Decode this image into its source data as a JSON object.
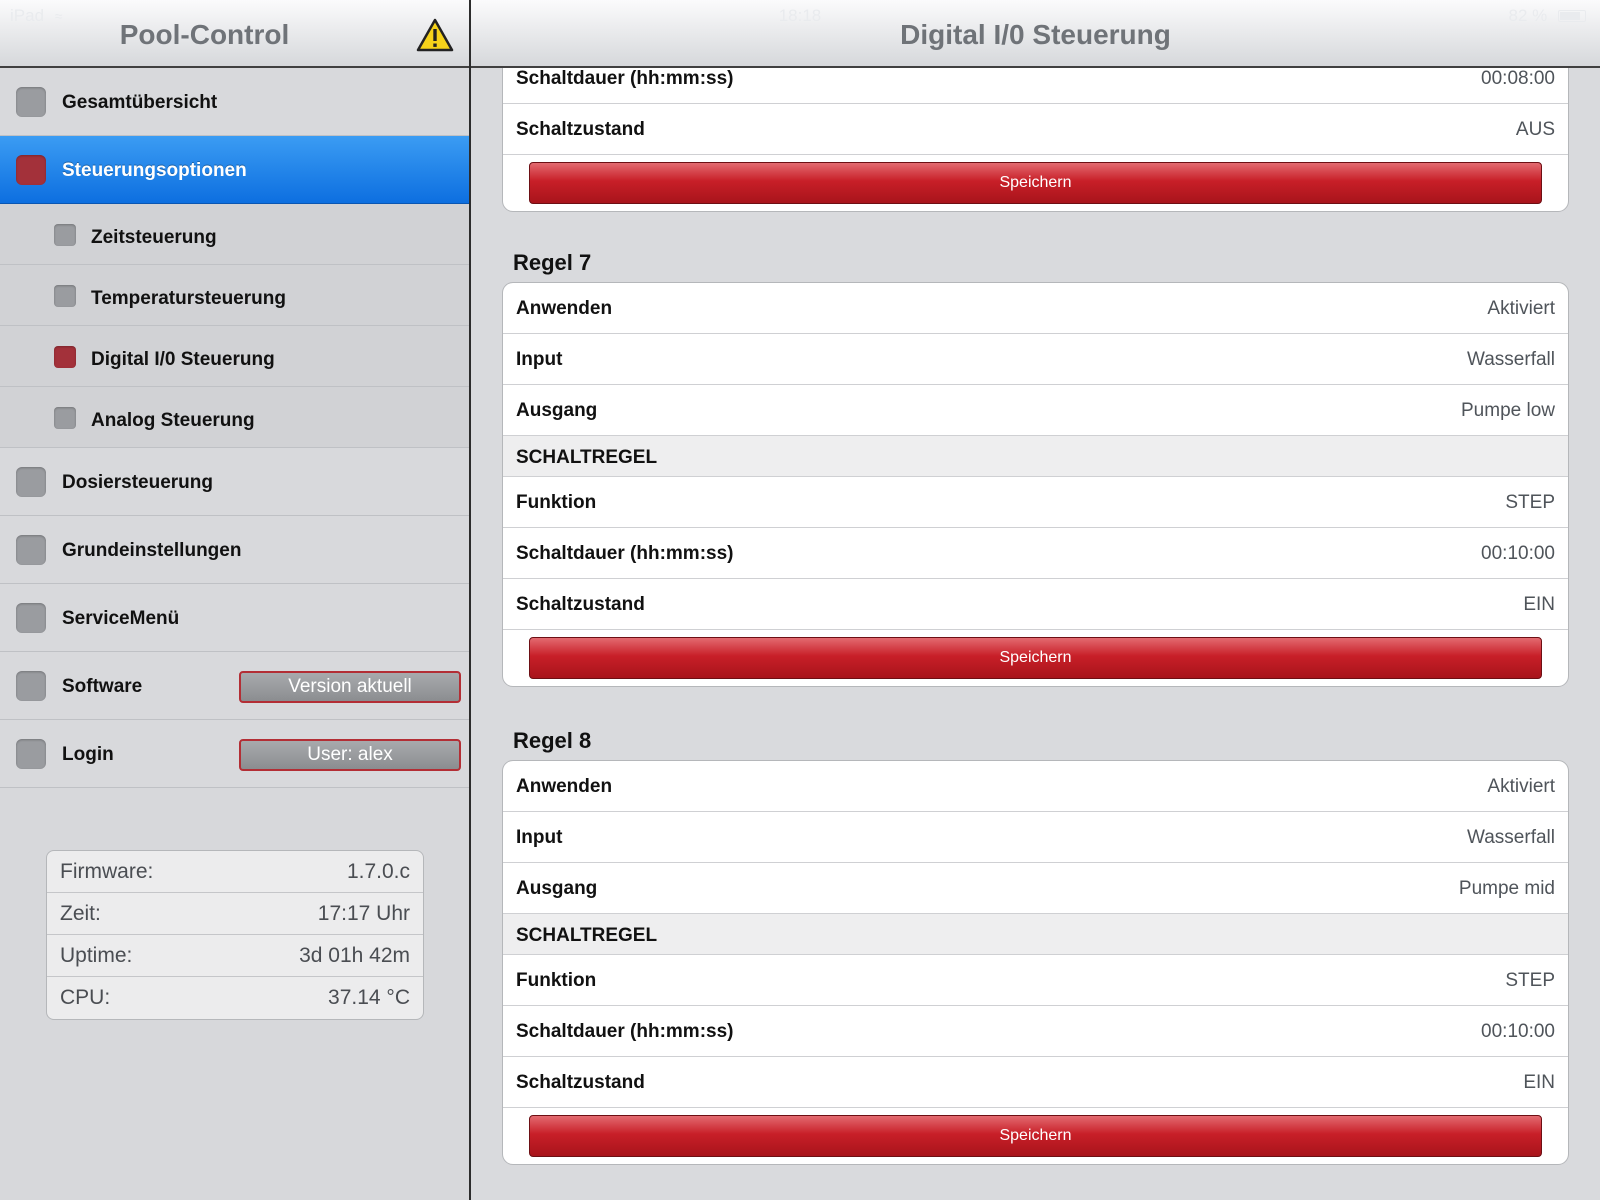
{
  "statusbar": {
    "device": "iPad",
    "time": "18:18",
    "battery": "82 %",
    "battery_level": 0.82
  },
  "left_nav": {
    "title": "Pool-Control"
  },
  "right_nav": {
    "title": "Digital I/0 Steuerung"
  },
  "sidebar": {
    "items": [
      {
        "label": "Gesamtübersicht"
      },
      {
        "label": "Steuerungsoptionen"
      },
      {
        "label": "Zeitsteuerung"
      },
      {
        "label": "Temperatursteuerung"
      },
      {
        "label": "Digital I/0 Steuerung"
      },
      {
        "label": "Analog Steuerung"
      },
      {
        "label": "Dosiersteuerung"
      },
      {
        "label": "Grundeinstellungen"
      },
      {
        "label": "ServiceMenü"
      },
      {
        "label": "Software",
        "badge": "Version aktuell"
      },
      {
        "label": "Login",
        "badge": "User: alex"
      }
    ],
    "info": [
      {
        "key": "Firmware:",
        "value": "1.7.0.c"
      },
      {
        "key": "Zeit:",
        "value": "17:17 Uhr"
      },
      {
        "key": "Uptime:",
        "value": "3d 01h 42m"
      },
      {
        "key": "CPU:",
        "value": "37.14 °C"
      }
    ]
  },
  "colors": {
    "accent_blue": "#1a7ee8",
    "save_red": "#c81f28",
    "indicator_red": "#a3313a",
    "indicator_gray": "#9a9ca0"
  },
  "main": {
    "save_label": "Speichern",
    "partial_rule": {
      "rows": [
        {
          "key": "Schaltdauer (hh:mm:ss)",
          "value": "00:08:00"
        },
        {
          "key": "Schaltzustand",
          "value": "AUS"
        }
      ]
    },
    "rules": [
      {
        "title": "Regel 7",
        "rows": [
          {
            "key": "Anwenden",
            "value": "Aktiviert"
          },
          {
            "key": "Input",
            "value": "Wasserfall"
          },
          {
            "key": "Ausgang",
            "value": "Pumpe low"
          }
        ],
        "section": "SCHALTREGEL",
        "rule_rows": [
          {
            "key": "Funktion",
            "value": "STEP"
          },
          {
            "key": "Schaltdauer (hh:mm:ss)",
            "value": "00:10:00"
          },
          {
            "key": "Schaltzustand",
            "value": "EIN"
          }
        ]
      },
      {
        "title": "Regel 8",
        "rows": [
          {
            "key": "Anwenden",
            "value": "Aktiviert"
          },
          {
            "key": "Input",
            "value": "Wasserfall"
          },
          {
            "key": "Ausgang",
            "value": "Pumpe mid"
          }
        ],
        "section": "SCHALTREGEL",
        "rule_rows": [
          {
            "key": "Funktion",
            "value": "STEP"
          },
          {
            "key": "Schaltdauer (hh:mm:ss)",
            "value": "00:10:00"
          },
          {
            "key": "Schaltzustand",
            "value": "EIN"
          }
        ]
      }
    ]
  }
}
